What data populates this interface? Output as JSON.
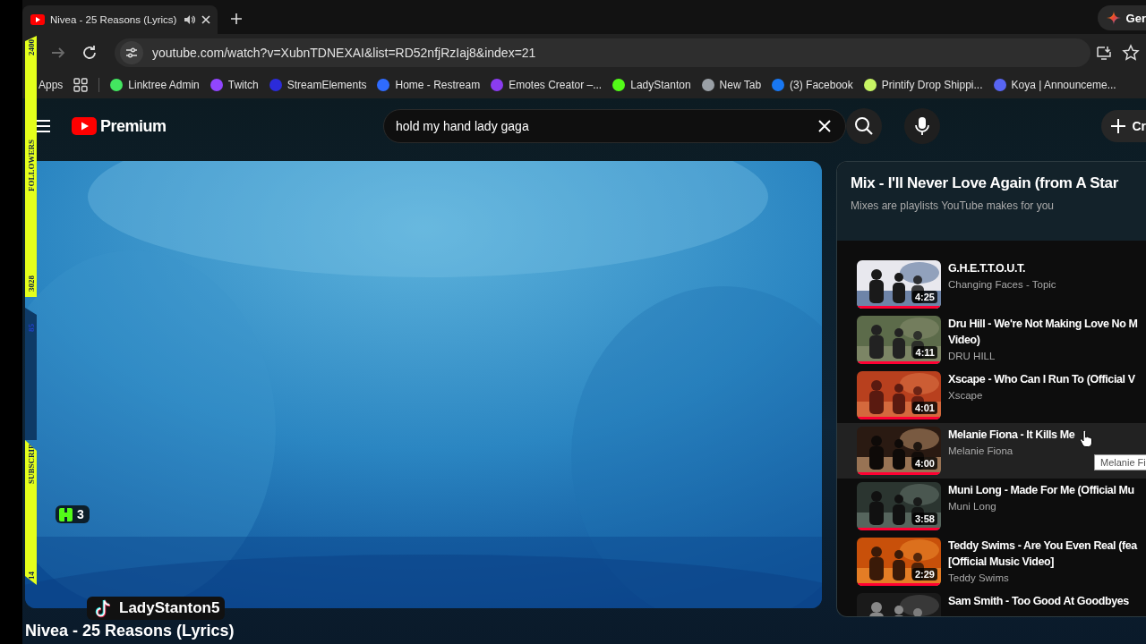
{
  "browser": {
    "tabs": [
      {
        "title": "Nivea - 25 Reasons (Lyrics)",
        "selected": true,
        "audio": true
      }
    ],
    "gemini_button": "Ger",
    "forward_disabled": true,
    "address": "youtube.com/watch?v=XubnTDNEXAI&list=RD52nfjRzIaj8&index=21",
    "apps_label": "Apps",
    "bookmarks": [
      {
        "label": "Linktree Admin",
        "color": "#43e660"
      },
      {
        "label": "Twitch",
        "color": "#9146ff"
      },
      {
        "label": "StreamElements",
        "color": "#2b2bd9"
      },
      {
        "label": "Home - Restream",
        "color": "#2f6bff"
      },
      {
        "label": "Emotes Creator –...",
        "color": "#8a3cf0"
      },
      {
        "label": "LadyStanton",
        "color": "#53fc18"
      },
      {
        "label": "New Tab",
        "color": "#9aa0a6"
      },
      {
        "label": "(3) Facebook",
        "color": "#1877f2"
      },
      {
        "label": "Printify Drop Shippi...",
        "color": "#c7f464"
      },
      {
        "label": "Koya | Announceme...",
        "color": "#5865f2"
      }
    ]
  },
  "youtube": {
    "logo_label": "Premium",
    "search": {
      "value": "hold my hand lady gaga"
    },
    "create_button": "Cr",
    "video_title": "Nivea - 25 Reasons (Lyrics)",
    "playlist": {
      "title": "Mix - I'll Never Love Again (from A Star",
      "subtitle": "Mixes are playlists YouTube makes for you",
      "items": [
        {
          "title_lines": [
            "G.H.E.T.T.O.U.T."
          ],
          "channel": "Changing Faces - Topic",
          "duration": "4:25",
          "hovered": false
        },
        {
          "title_lines": [
            "Dru Hill - We're Not Making Love No M",
            "Video)"
          ],
          "channel": "DRU HILL",
          "duration": "4:11",
          "hovered": false
        },
        {
          "title_lines": [
            "Xscape - Who Can I Run To (Official V"
          ],
          "channel": "Xscape",
          "duration": "4:01",
          "hovered": false
        },
        {
          "title_lines": [
            "Melanie Fiona - It Kills Me"
          ],
          "channel": "Melanie Fiona",
          "duration": "4:00",
          "hovered": true
        },
        {
          "title_lines": [
            "Muni Long - Made For Me (Official Mu"
          ],
          "channel": "Muni Long",
          "duration": "3:58",
          "hovered": false
        },
        {
          "title_lines": [
            "Teddy Swims - Are You Even Real (fea",
            "[Official Music Video]"
          ],
          "channel": "Teddy Swims",
          "duration": "2:29",
          "hovered": false
        },
        {
          "title_lines": [
            "Sam Smith - Too Good At Goodbyes"
          ],
          "hovered": false
        }
      ]
    },
    "tooltip": "Melanie Fi"
  },
  "stream_overlay": {
    "follower_goal": {
      "top_number": "2400",
      "label": "FOLLOWERS",
      "bottom_number": "3028"
    },
    "subscriber_goal": {
      "top_number": "85",
      "label": "SUBSCRIB",
      "bottom_number": "14"
    },
    "viewer_count": "3",
    "tiktok_handle": "LadyStanton5"
  }
}
